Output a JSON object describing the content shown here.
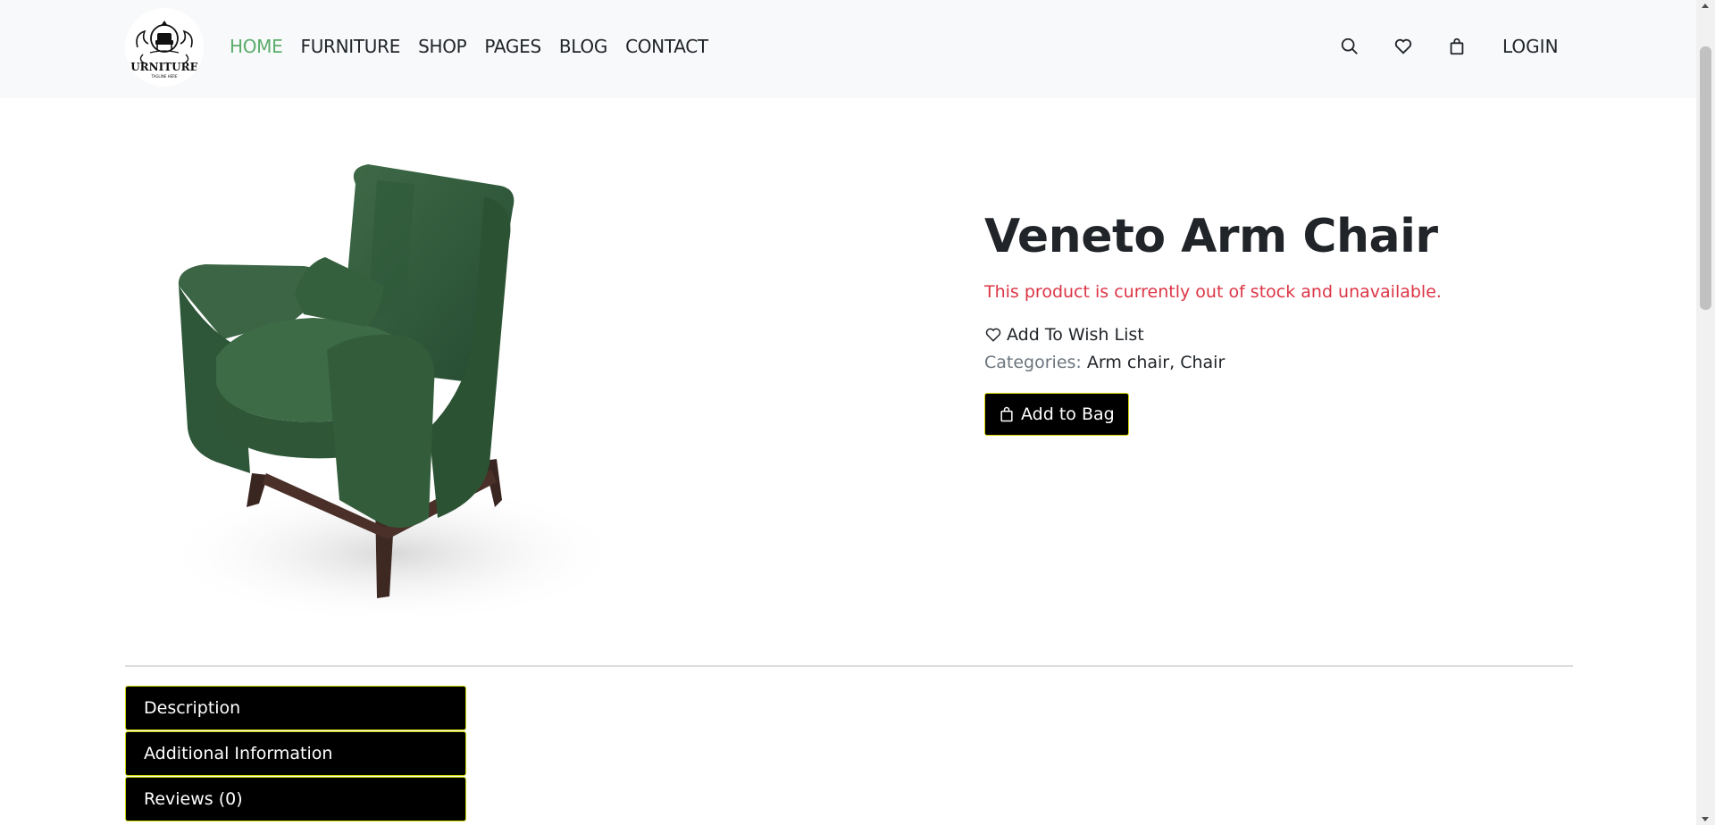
{
  "brand": {
    "logo_text": "URNITURE",
    "tagline": "TAGLINE HERE"
  },
  "nav": {
    "items": [
      {
        "label": "HOME",
        "active": true
      },
      {
        "label": "FURNITURE"
      },
      {
        "label": "SHOP"
      },
      {
        "label": "PAGES"
      },
      {
        "label": "BLOG"
      },
      {
        "label": "CONTACT"
      }
    ],
    "icons": [
      "search-icon",
      "heart-icon",
      "shopping-bag-icon"
    ],
    "login_label": "LOGIN",
    "active_color": "#5aad6a"
  },
  "product": {
    "title": "Veneto Arm Chair",
    "stock_message": "This product is currently out of stock and unavailable.",
    "wishlist_label": "Add To Wish List",
    "categories_label": "Categories:",
    "categories": [
      "Arm chair",
      "Chair"
    ],
    "add_to_bag_label": "Add to Bag",
    "image_alt": "green velvet armchair",
    "stock_color": "#dc3545"
  },
  "tabs": [
    {
      "label": "Description"
    },
    {
      "label": "Additional Information"
    },
    {
      "label": "Reviews (0)"
    }
  ]
}
